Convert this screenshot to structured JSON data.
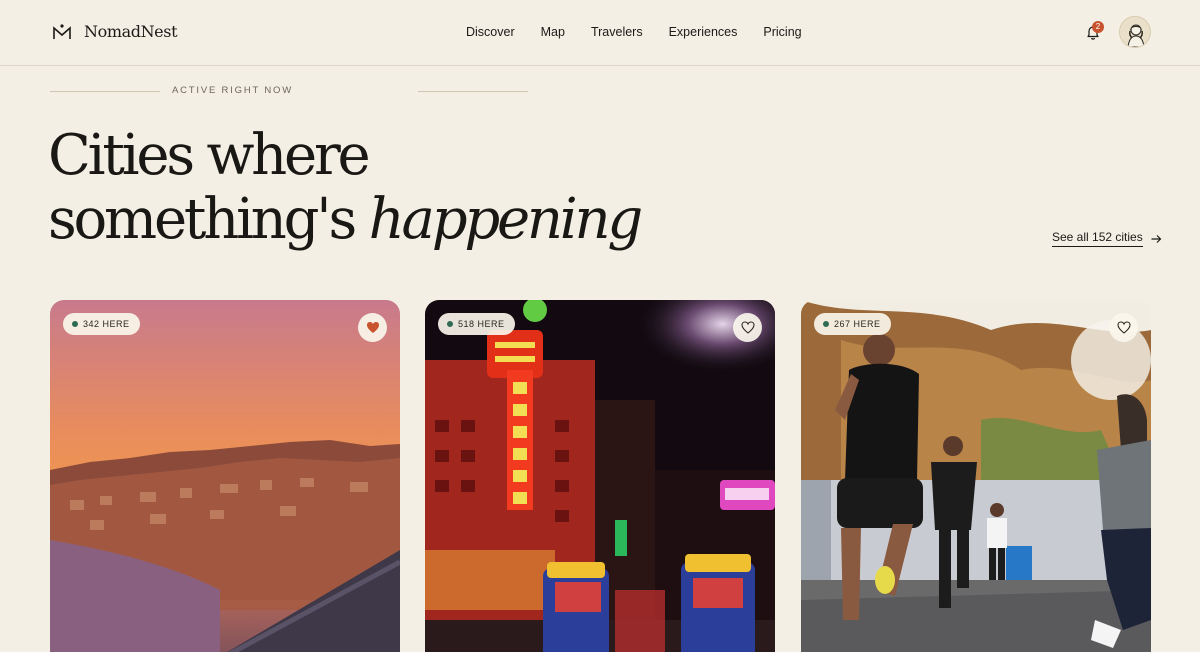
{
  "brand": {
    "name": "NomadNest"
  },
  "nav": [
    "Discover",
    "Map",
    "Travelers",
    "Experiences",
    "Pricing"
  ],
  "notifications": {
    "count": "2"
  },
  "hero": {
    "eyebrow": "ACTIVE RIGHT NOW",
    "title_line1": "Cities where",
    "title_line2_plain": "something's",
    "title_line2_italic": "happening",
    "see_all": "See all 152 cities"
  },
  "cards": [
    {
      "count_label": "342 HERE",
      "favorited": true
    },
    {
      "count_label": "518 HERE",
      "favorited": false
    },
    {
      "count_label": "267 HERE",
      "favorited": false
    }
  ],
  "colors": {
    "background": "#f3efe4",
    "accent": "#c8542e",
    "active_dot": "#2e6b52"
  }
}
